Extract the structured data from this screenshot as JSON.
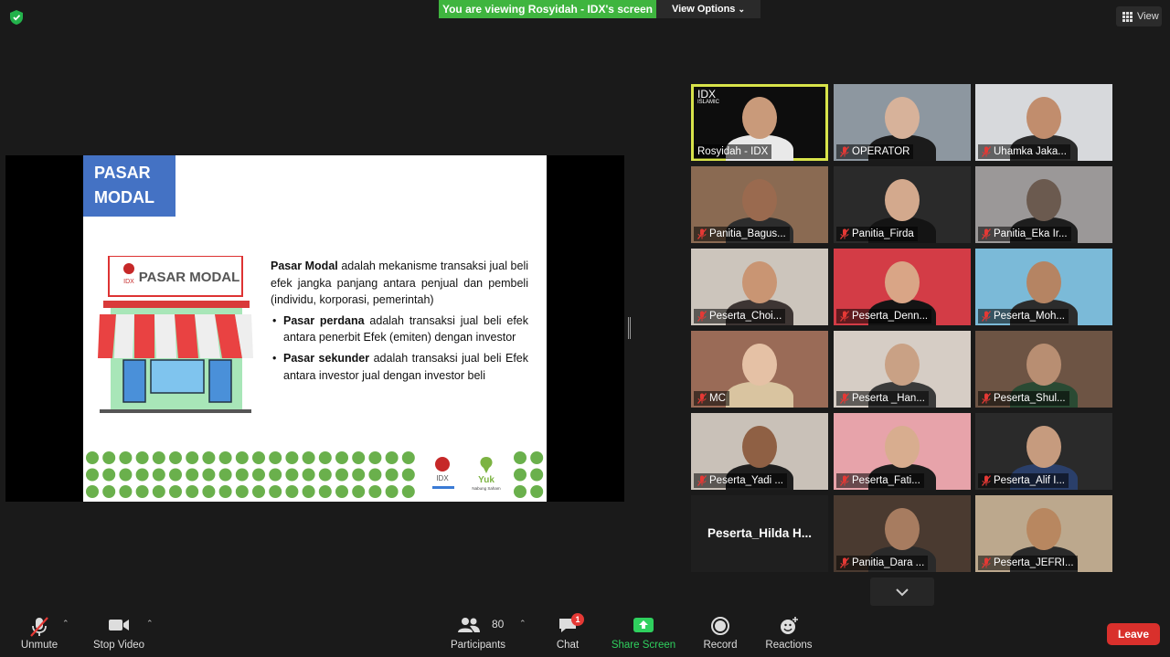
{
  "top_bar": {
    "viewing_banner": "You are viewing Rosyidah - IDX's screen",
    "view_options": "View Options",
    "view_label": "View"
  },
  "slide": {
    "title_line1": "PASAR",
    "title_line2": "MODAL",
    "sign_text": "PASAR MODAL",
    "para_bold": "Pasar Modal",
    "para_rest": " adalah mekanisme transaksi jual beli efek jangka panjang antara penjual dan pembeli (individu, korporasi, pemerintah)",
    "bullet1_bold": "Pasar perdana",
    "bullet1_rest": " adalah transaksi jual beli efek antara penerbit Efek (emiten) dengan investor",
    "bullet2_bold": "Pasar sekunder",
    "bullet2_rest": " adalah transaksi jual beli Efek antara investor jual dengan investor beli",
    "logo_idx": "IDX",
    "logo_yuk": "Yuk",
    "logo_yuk_sub": "Nabung Saham"
  },
  "gallery": [
    {
      "name": "Rosyidah - IDX",
      "muted": false,
      "active": true,
      "bg": "#0d0d0d",
      "skin": "#c99a7a",
      "cloth": "#e9e9e9",
      "overlay": "IDX",
      "overlay_sub": "ISLAMIC"
    },
    {
      "name": "OPERATOR",
      "muted": true,
      "bg": "#8d97a0",
      "skin": "#d7b29a",
      "cloth": "#1b1b1b"
    },
    {
      "name": "Uhamka Jaka...",
      "muted": true,
      "bg": "#d7d9dc",
      "skin": "#c18d6d",
      "cloth": "#2a2a2a"
    },
    {
      "name": "Panitia_Bagus...",
      "muted": true,
      "bg": "#8a6a52",
      "skin": "#9a6a4f",
      "cloth": "#2d2d2d"
    },
    {
      "name": "Panitia_Firda",
      "muted": true,
      "bg": "#2a2a2a",
      "skin": "#d3a98d",
      "cloth": "#141414"
    },
    {
      "name": "Panitia_Eka Ir...",
      "muted": true,
      "bg": "#9b9898",
      "skin": "#6b5a4f",
      "cloth": "#1e1e1e"
    },
    {
      "name": "Peserta_Choi...",
      "muted": true,
      "bg": "#ccc5bc",
      "skin": "#c99573",
      "cloth": "#3d3533"
    },
    {
      "name": "Peserta_Denn...",
      "muted": true,
      "bg": "#d33c46",
      "skin": "#d9a586",
      "cloth": "#141414"
    },
    {
      "name": "Peserta_Moh...",
      "muted": true,
      "bg": "#7bbad8",
      "skin": "#b58463",
      "cloth": "#2c2c2c"
    },
    {
      "name": "MC",
      "muted": true,
      "bg": "#9a6b57",
      "skin": "#e5c1a5",
      "cloth": "#d9c4a0"
    },
    {
      "name": "Peserta _Han...",
      "muted": true,
      "bg": "#d6cdc5",
      "skin": "#c9a185",
      "cloth": "#3a3a3a"
    },
    {
      "name": "Peserta_Shul...",
      "muted": true,
      "bg": "#6d5444",
      "skin": "#b88e72",
      "cloth": "#2a4a33"
    },
    {
      "name": "Peserta_Yadi ...",
      "muted": true,
      "bg": "#c9c1b8",
      "skin": "#8f6044",
      "cloth": "#1e1e1e"
    },
    {
      "name": "Peserta_Fati...",
      "muted": true,
      "bg": "#e7a3aa",
      "skin": "#d8ad8f",
      "cloth": "#1c1c1c"
    },
    {
      "name": "Peserta_Alif I...",
      "muted": true,
      "bg": "#2a2a2a",
      "skin": "#c69b7e",
      "cloth": "#2a3f6a"
    },
    {
      "name": "Panitia_Dara ...",
      "muted": true,
      "bg": "#4a3a30",
      "skin": "#a77c60",
      "cloth": "#2a2a2a"
    },
    {
      "name": "Peserta_JEFRI...",
      "muted": true,
      "bg": "#bca88d",
      "skin": "#b88760",
      "cloth": "#2a2a2a"
    }
  ],
  "name_only_tile": "Peserta_Hilda  H...",
  "toolbar": {
    "unmute": "Unmute",
    "stop_video": "Stop Video",
    "participants": "Participants",
    "participants_count": "80",
    "chat": "Chat",
    "chat_badge": "1",
    "share_screen": "Share Screen",
    "record": "Record",
    "reactions": "Reactions",
    "leave": "Leave"
  },
  "colors": {
    "banner_green": "#3fb53f",
    "share_green": "#2fd05e",
    "leave_red": "#d9302c",
    "active_speaker": "#d8e34a",
    "slide_title_blue": "#4472c4",
    "dot_green": "#6ab04c"
  }
}
